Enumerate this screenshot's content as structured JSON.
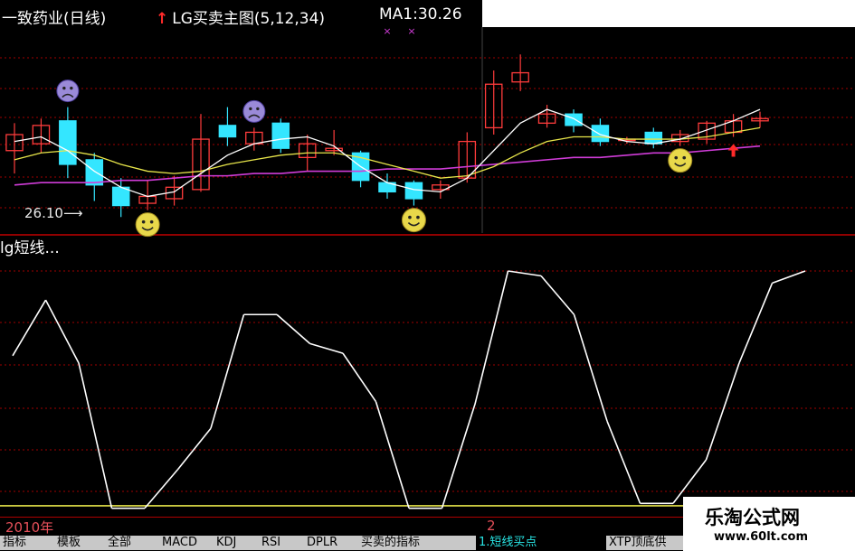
{
  "header": {
    "stock_title": "一致药业(日线)",
    "indicator_name": "LG买卖主图(5,12,34)",
    "ma_readout": "MA1:30.26"
  },
  "annotations": {
    "low_price": "26.10"
  },
  "lower_panel": {
    "title": "lg短线..."
  },
  "time_axis": {
    "year": "2010年",
    "month": "2"
  },
  "tabs": [
    {
      "label": "指标"
    },
    {
      "label": "模板"
    },
    {
      "label": "全部"
    },
    {
      "label": "MACD"
    },
    {
      "label": "KDJ"
    },
    {
      "label": "RSI"
    },
    {
      "label": "DPLR"
    },
    {
      "label": "买卖的指标"
    },
    {
      "label": "1.短线买点"
    },
    {
      "label": "XTP顶底供"
    }
  ],
  "watermark": {
    "title": "乐淘公式网",
    "url": "www.60lt.com"
  },
  "colors": {
    "up_candle": "#ff3c3c",
    "down_candle": "#34e6ff",
    "ma_white": "#ffffff",
    "ma_yellow": "#e8e64a",
    "ma_magenta": "#d03cd8",
    "grid": "#a00000",
    "oscillator": "#ffffff",
    "threshold": "#e8e64a"
  },
  "chart_data": [
    {
      "type": "candlestick",
      "title": "一致药业(日线)",
      "candles": [
        {
          "o": 29.0,
          "h": 30.2,
          "l": 28.0,
          "c": 29.7
        },
        {
          "o": 29.3,
          "h": 30.4,
          "l": 28.9,
          "c": 30.1
        },
        {
          "o": 30.3,
          "h": 30.9,
          "l": 27.8,
          "c": 28.4
        },
        {
          "o": 28.6,
          "h": 28.9,
          "l": 26.8,
          "c": 27.5
        },
        {
          "o": 27.4,
          "h": 27.8,
          "l": 26.1,
          "c": 26.6
        },
        {
          "o": 26.7,
          "h": 27.7,
          "l": 26.4,
          "c": 27.0
        },
        {
          "o": 26.9,
          "h": 27.9,
          "l": 26.6,
          "c": 27.4
        },
        {
          "o": 27.3,
          "h": 30.6,
          "l": 27.2,
          "c": 29.5
        },
        {
          "o": 30.1,
          "h": 30.9,
          "l": 29.2,
          "c": 29.6
        },
        {
          "o": 29.3,
          "h": 30.0,
          "l": 29.0,
          "c": 29.8
        },
        {
          "o": 30.2,
          "h": 30.4,
          "l": 28.9,
          "c": 29.1
        },
        {
          "o": 28.7,
          "h": 29.7,
          "l": 28.1,
          "c": 29.3
        },
        {
          "o": 29.0,
          "h": 29.9,
          "l": 28.8,
          "c": 29.1
        },
        {
          "o": 28.9,
          "h": 29.0,
          "l": 27.4,
          "c": 27.7
        },
        {
          "o": 27.6,
          "h": 28.0,
          "l": 26.9,
          "c": 27.2
        },
        {
          "o": 27.6,
          "h": 27.7,
          "l": 26.6,
          "c": 26.9
        },
        {
          "o": 27.3,
          "h": 27.7,
          "l": 26.9,
          "c": 27.5
        },
        {
          "o": 27.8,
          "h": 29.8,
          "l": 27.6,
          "c": 29.4
        },
        {
          "o": 30.0,
          "h": 32.5,
          "l": 29.7,
          "c": 31.9
        },
        {
          "o": 32.0,
          "h": 33.2,
          "l": 31.6,
          "c": 32.4
        },
        {
          "o": 30.2,
          "h": 31.0,
          "l": 30.0,
          "c": 30.6
        },
        {
          "o": 30.6,
          "h": 30.8,
          "l": 29.8,
          "c": 30.1
        },
        {
          "o": 30.1,
          "h": 30.4,
          "l": 29.2,
          "c": 29.4
        },
        {
          "o": 29.5,
          "h": 29.6,
          "l": 29.3,
          "c": 29.5
        },
        {
          "o": 29.8,
          "h": 30.0,
          "l": 29.1,
          "c": 29.3
        },
        {
          "o": 29.4,
          "h": 29.9,
          "l": 29.2,
          "c": 29.7
        },
        {
          "o": 29.5,
          "h": 30.3,
          "l": 29.3,
          "c": 30.2
        },
        {
          "o": 29.8,
          "h": 30.6,
          "l": 29.6,
          "c": 30.3
        },
        {
          "o": 30.3,
          "h": 30.7,
          "l": 30.0,
          "c": 30.4
        }
      ],
      "ma_white": [
        29.4,
        29.6,
        29.0,
        28.1,
        27.4,
        27.0,
        27.2,
        28.0,
        28.8,
        29.3,
        29.5,
        29.6,
        29.2,
        28.3,
        27.6,
        27.3,
        27.2,
        27.8,
        29.0,
        30.2,
        30.8,
        30.4,
        29.7,
        29.4,
        29.3,
        29.5,
        29.9,
        30.3,
        30.8
      ],
      "ma_yellow": [
        28.6,
        28.9,
        29.0,
        28.8,
        28.4,
        28.1,
        28.0,
        28.1,
        28.4,
        28.6,
        28.8,
        28.9,
        28.9,
        28.7,
        28.4,
        28.1,
        27.8,
        27.9,
        28.3,
        28.9,
        29.4,
        29.6,
        29.6,
        29.5,
        29.5,
        29.5,
        29.6,
        29.8,
        30.0
      ],
      "ma_magenta": [
        27.5,
        27.6,
        27.6,
        27.6,
        27.7,
        27.7,
        27.8,
        27.9,
        27.9,
        28.0,
        28.0,
        28.1,
        28.1,
        28.1,
        28.2,
        28.2,
        28.2,
        28.3,
        28.4,
        28.5,
        28.6,
        28.7,
        28.7,
        28.8,
        28.9,
        28.9,
        29.0,
        29.1,
        29.2
      ],
      "ylim": [
        25.4,
        34.0
      ],
      "buy_signals": [
        5,
        15,
        25
      ],
      "sell_signals": [
        2,
        9
      ],
      "arrow_signal": 27
    },
    {
      "type": "line",
      "title": "lg短线...",
      "series": [
        {
          "values": [
            65,
            88,
            62,
            2,
            2,
            18,
            35,
            82,
            82,
            70,
            66,
            46,
            2,
            2,
            45,
            100,
            98,
            82,
            38,
            4,
            4,
            22,
            62,
            95,
            100
          ]
        }
      ],
      "threshold": 3,
      "ylim": [
        0,
        100
      ]
    }
  ]
}
